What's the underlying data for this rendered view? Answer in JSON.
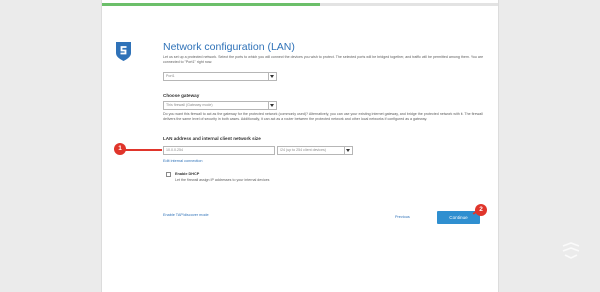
{
  "wizard": {
    "progress": 0.55,
    "title": "Network configuration (LAN)",
    "intro": "Let us set up a protected network. Select the ports to which you will connect the devices you wish to protect. The selected ports will be bridged together, and traffic will be permitted among them. You are connected to \"Port1\" right now.",
    "port_select": {
      "value": "Port1"
    },
    "gateway": {
      "label": "Choose gateway",
      "select_value": "This firewall (Gateway mode)",
      "description": "Do you want this firewall to act as the gateway for the protected network (commonly used)? Alternatively, you can use your existing internet gateway, and bridge the protected network with it. The firewall delivers the same level of security in both cases. Additionally, it can act as a router between the protected network and other local networks if configured as a gateway."
    },
    "lan": {
      "label": "LAN address and internal client network size",
      "address_value": "10.0.0.254",
      "size_value": "/24 (up to 254 client devices)",
      "edit_link": "Edit internal connection"
    },
    "dhcp": {
      "label": "Enable DHCP",
      "description": "Let the firewall assign IP addresses to your internal devices"
    },
    "footer": {
      "tap_link": "Enable TAP/discover mode",
      "previous": "Previous",
      "continue": "Continue"
    }
  },
  "annotations": {
    "badge_1": "1",
    "badge_2": "2"
  },
  "colors": {
    "accent": "#2f72b8",
    "button": "#2f8fd0",
    "progress": "#6cbf6a",
    "annotation": "#e0352b"
  }
}
